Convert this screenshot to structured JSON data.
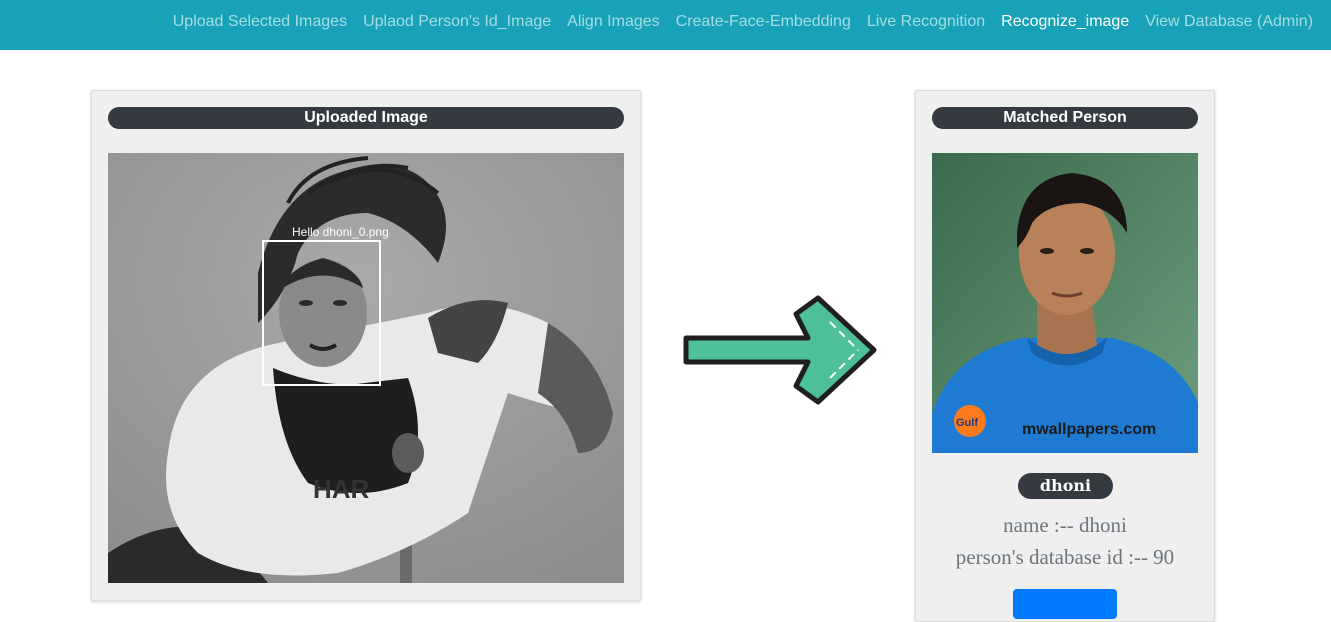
{
  "navbar": {
    "items": [
      {
        "label": "Upload Selected Images"
      },
      {
        "label": "Uplaod Person's Id_Image"
      },
      {
        "label": "Align Images"
      },
      {
        "label": "Create-Face-Embedding"
      },
      {
        "label": "Live Recognition"
      },
      {
        "label": "Recognize_image"
      },
      {
        "label": "View Database (Admin)"
      }
    ],
    "active_index": 5,
    "color": "#17a2b8"
  },
  "uploaded_card": {
    "title": "Uploaded Image",
    "face_box_label": "Hello dhoni_0.png"
  },
  "arrow": {
    "icon": "right-arrow-icon",
    "color": "#4dbf9b"
  },
  "matched_card": {
    "title": "Matched Person",
    "person_badge": "dhoni",
    "name_line": "name :-- dhoni",
    "id_line": "person's database id :-- 90",
    "watermark": "mwallpapers.com",
    "button_color": "#007bff"
  }
}
